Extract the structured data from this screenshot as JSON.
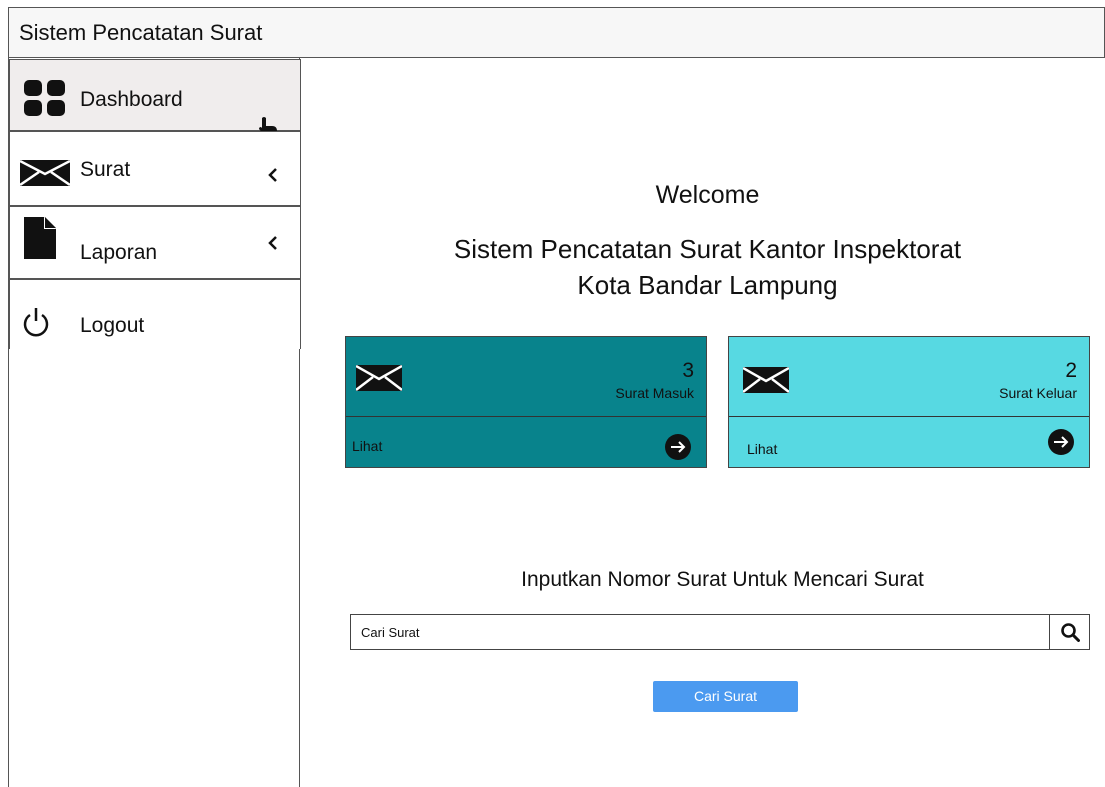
{
  "app": {
    "title": "Sistem Pencatatan Surat"
  },
  "sidebar": {
    "items": [
      {
        "label": "Dashboard",
        "icon": "dashboard-grid-icon",
        "active": true
      },
      {
        "label": "Surat",
        "icon": "envelope-icon",
        "has_submenu": true
      },
      {
        "label": "Laporan",
        "icon": "document-icon",
        "has_submenu": true
      },
      {
        "label": "Logout",
        "icon": "power-icon"
      }
    ]
  },
  "main": {
    "welcome": "Welcome",
    "subtitle_line1": "Sistem Pencatatan Surat Kantor Inspektorat",
    "subtitle_line2": "Kota Bandar Lampung",
    "cards": [
      {
        "count": "3",
        "label": "Surat Masuk",
        "link": "Lihat",
        "color": "#08838c",
        "icon": "envelope-icon"
      },
      {
        "count": "2",
        "label": "Surat Keluar",
        "link": "Lihat",
        "color": "#57d9e2",
        "icon": "envelope-icon"
      }
    ],
    "search": {
      "title": "Inputkan Nomor Surat Untuk Mencari Surat",
      "placeholder": "Cari Surat",
      "button_label": "Cari Surat",
      "button_color": "#4b9af0"
    }
  }
}
